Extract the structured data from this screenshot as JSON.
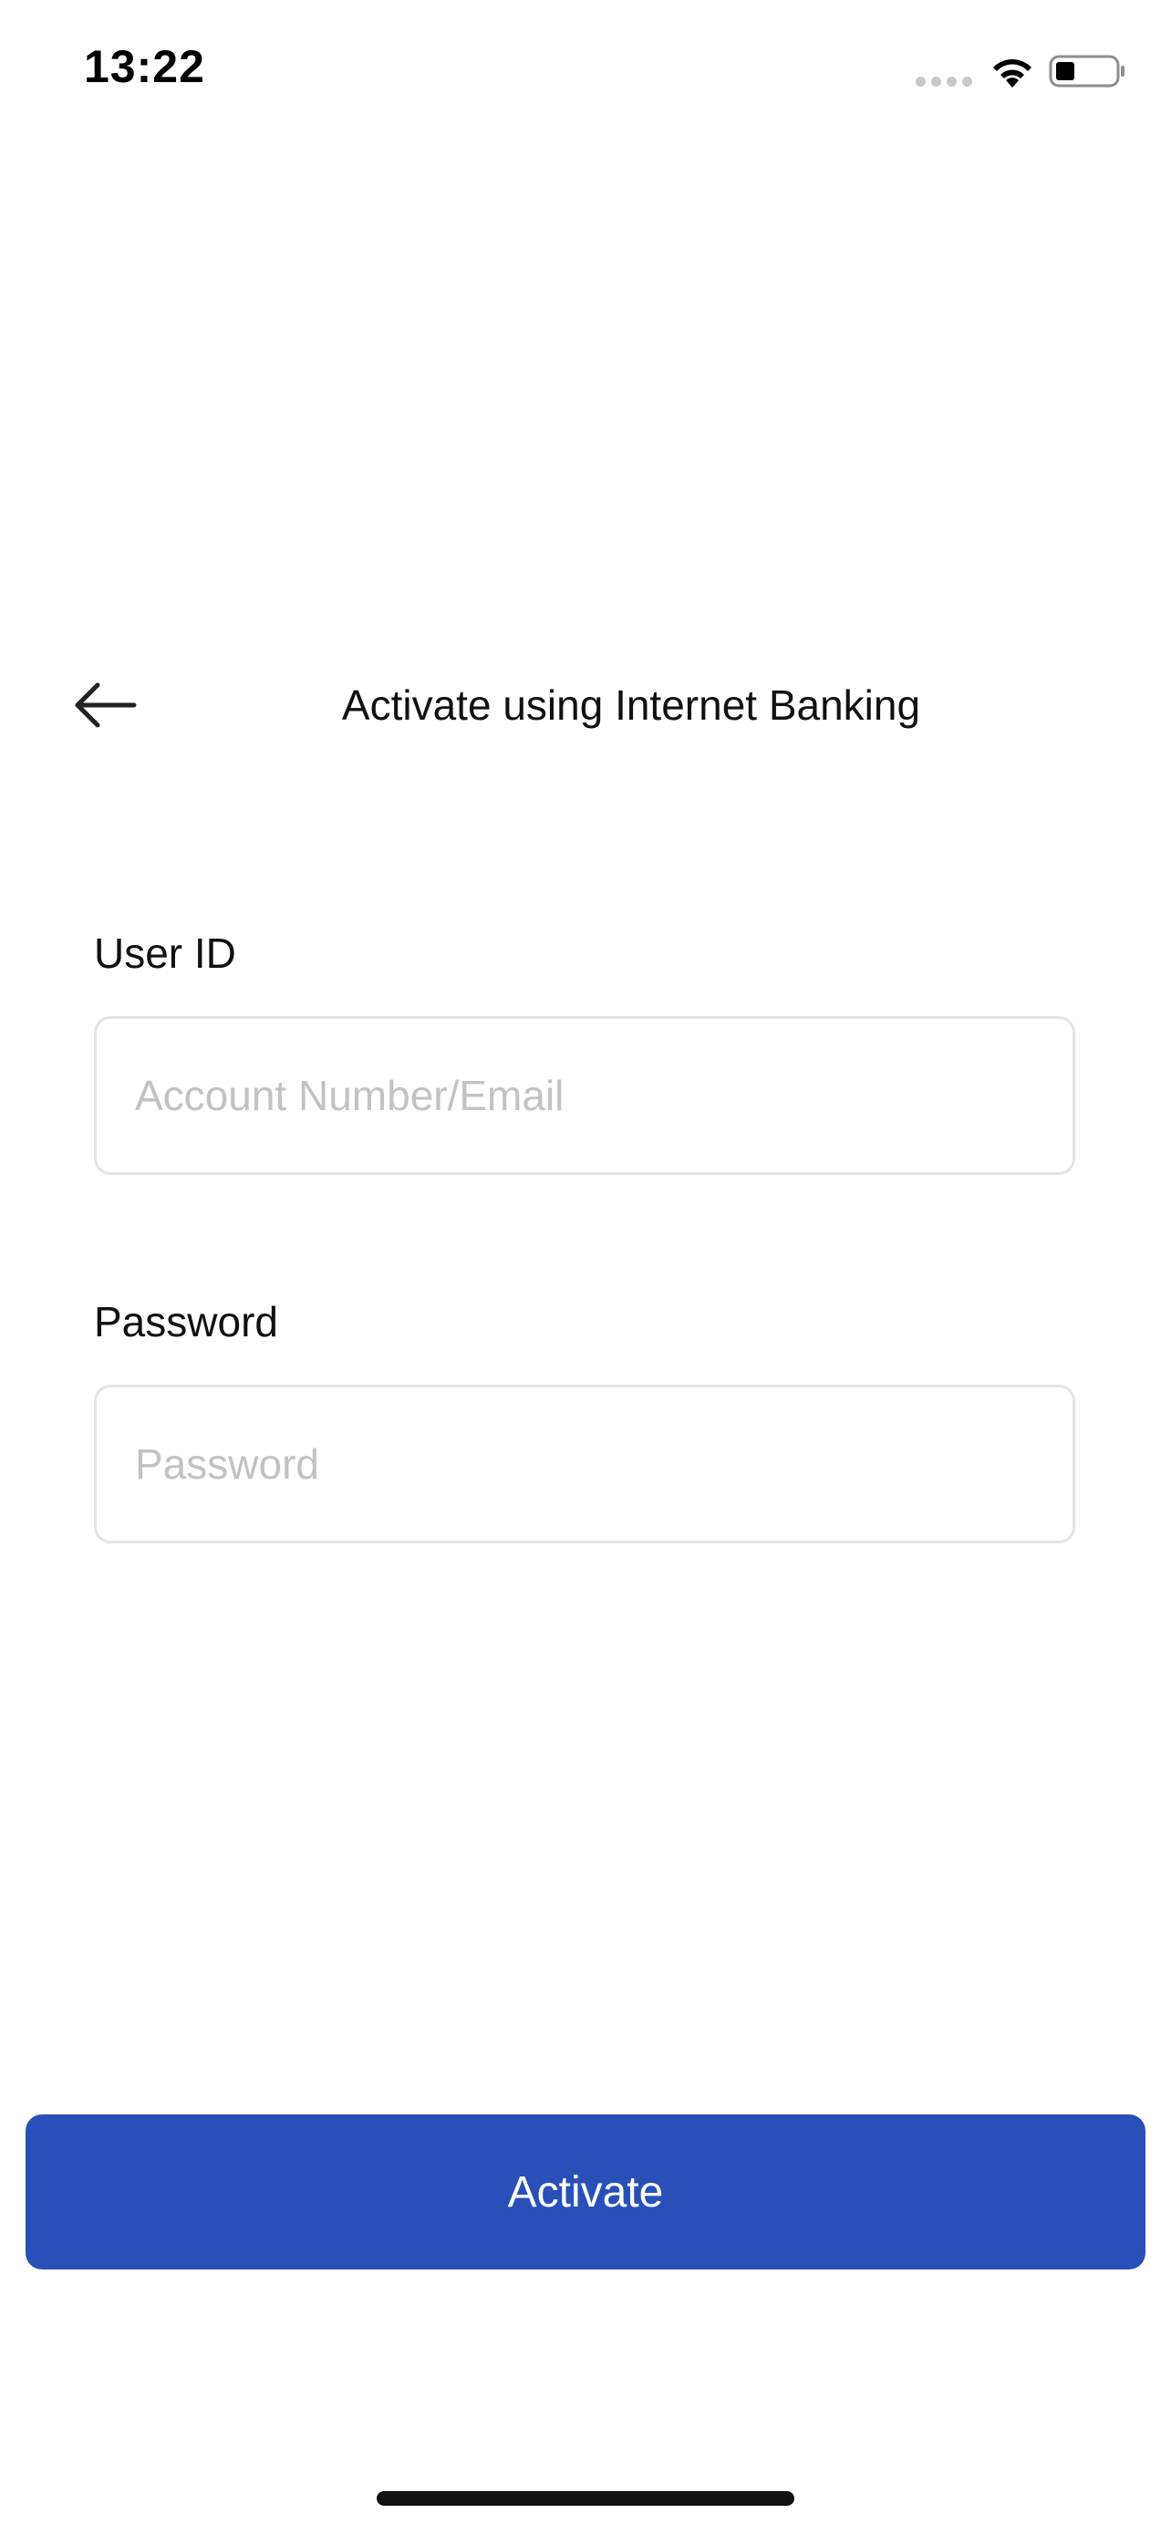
{
  "status_bar": {
    "time": "13:22",
    "icons": [
      "signal-dots-icon",
      "wifi-icon",
      "battery-icon"
    ]
  },
  "header": {
    "title": "Activate using Internet Banking",
    "back_icon": "arrow-left-icon"
  },
  "form": {
    "user_id": {
      "label": "User ID",
      "placeholder": "Account Number/Email",
      "value": ""
    },
    "password": {
      "label": "Password",
      "placeholder": "Password",
      "value": ""
    }
  },
  "actions": {
    "activate_label": "Activate"
  },
  "colors": {
    "primary": "#2850b8",
    "background": "#ffffff",
    "input_border": "#e4e4e8",
    "placeholder": "#c2c2c6"
  }
}
